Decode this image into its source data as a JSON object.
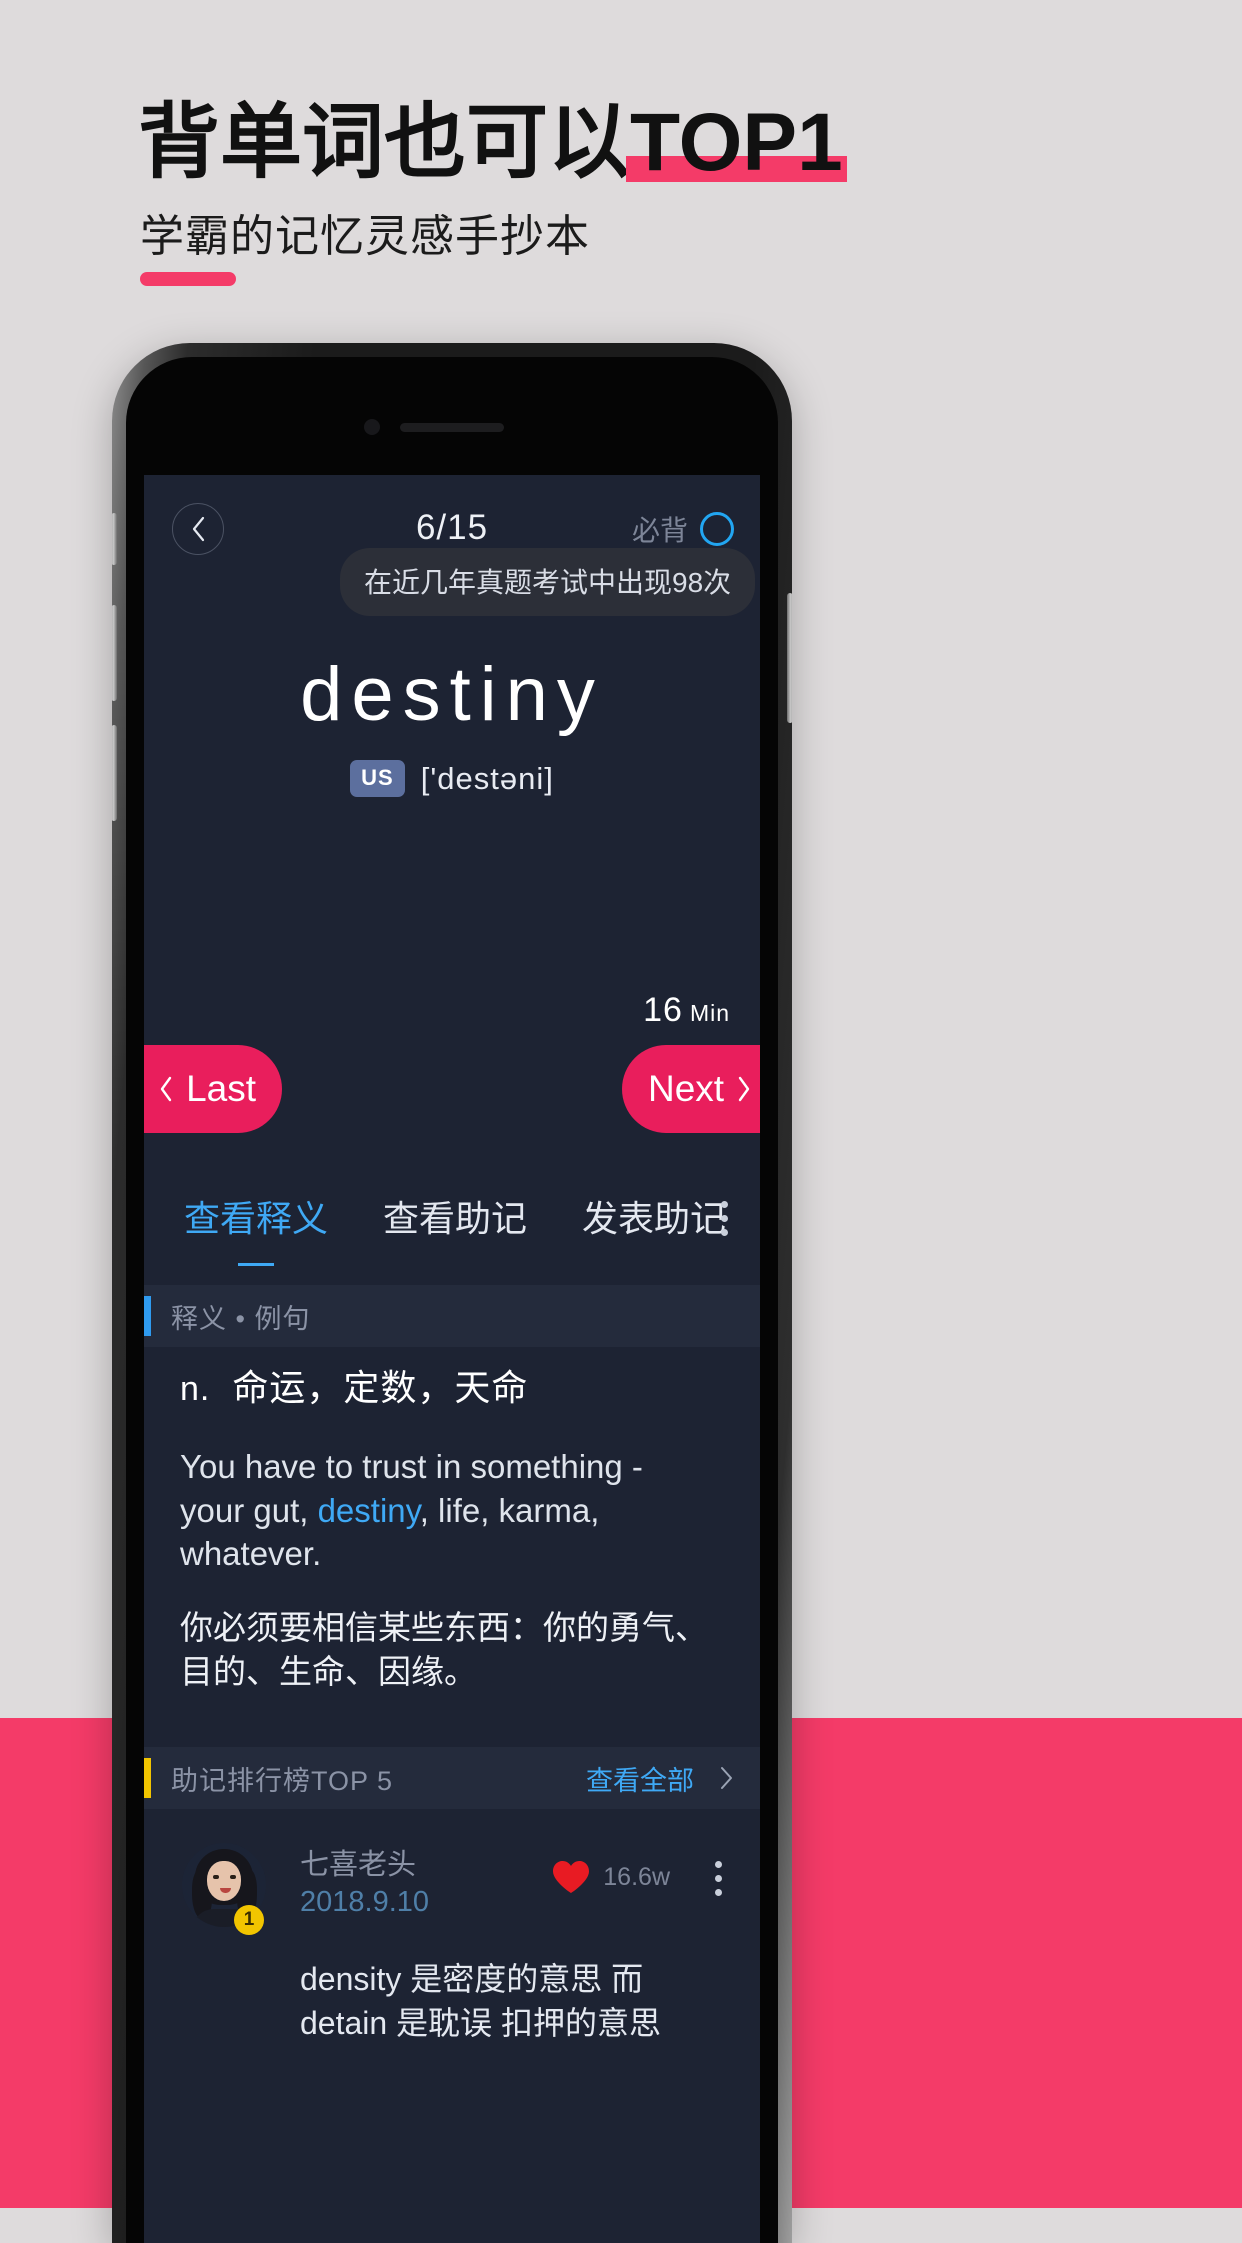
{
  "promo": {
    "title_prefix": "背单词也可以",
    "title_highlight": "TOP1",
    "subtitle": "学霸的记忆灵感手抄本"
  },
  "app": {
    "header": {
      "back_icon": "chevron-left-icon",
      "page_counter": "6/15",
      "must_learn_label": "必背",
      "must_learn_icon": "circle-toggle-icon"
    },
    "frequency_tooltip": "在近几年真题考试中出现98次",
    "word": {
      "text": "destiny",
      "accent_badge": "US",
      "phonetic": "['destəni]"
    },
    "timer": {
      "value": "16",
      "unit": "Min"
    },
    "nav": {
      "last_label": "Last",
      "last_icon": "chevron-left-icon",
      "next_label": "Next",
      "next_icon": "chevron-right-icon"
    },
    "tabs": [
      {
        "label": "查看释义",
        "active": true
      },
      {
        "label": "查看助记",
        "active": false
      },
      {
        "label": "发表助记",
        "active": false
      }
    ],
    "tab_more_icon": "vertical-dots-icon",
    "definition_section": {
      "title": "释义 • 例句",
      "accent_color": "#2f9bf0",
      "pos": "n.",
      "meaning": "命运，定数，天命",
      "example_en_line1": "You have to trust in something -",
      "example_en_line2_pre": "your gut, ",
      "example_en_keyword": "destiny",
      "example_en_line2_post": ", life, karma, whatever.",
      "example_cn": "你必须要相信某些东西：你的勇气、目的、生命、因缘。"
    },
    "rank_section": {
      "title": "助记排行榜TOP 5",
      "accent_color": "#f2c500",
      "view_all_label": "查看全部",
      "view_all_icon": "chevron-right-icon"
    },
    "comment": {
      "rank_badge": "1",
      "avatar_icon": "user-avatar",
      "username": "七喜老头",
      "date": "2018.9.10",
      "like_icon": "heart-icon",
      "like_count": "16.6w",
      "more_icon": "vertical-dots-icon",
      "text": "density 是密度的意思  而 detain 是耽误 扣押的意思"
    }
  },
  "colors": {
    "brand_pink": "#f43b68",
    "accent_blue": "#3fa9f5",
    "accent_yellow": "#f2c500",
    "screen_bg": "#1d2333"
  }
}
